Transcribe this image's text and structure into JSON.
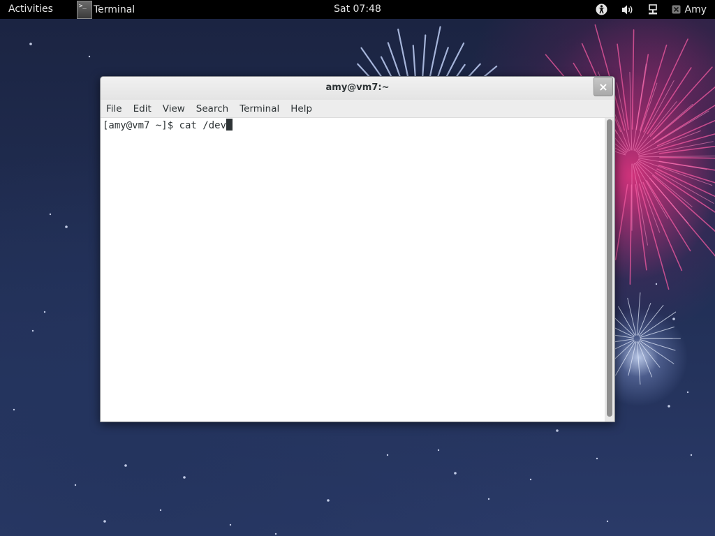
{
  "topbar": {
    "activities": "Activities",
    "app_name": "Terminal",
    "app_icon_glyph": ">_",
    "clock": "Sat 07:48",
    "user": "Amy",
    "icons": [
      "accessibility-icon",
      "volume-icon",
      "network-icon",
      "user-status-icon"
    ]
  },
  "window": {
    "title": "amy@vm7:~",
    "close_glyph": "×",
    "menu": [
      "File",
      "Edit",
      "View",
      "Search",
      "Terminal",
      "Help"
    ],
    "terminal": {
      "prompt": "[amy@vm7 ~]$ ",
      "command": "cat /dev"
    }
  },
  "colors": {
    "topbar_bg": "#000000",
    "wallpaper_base": "#1f2b4f",
    "firework_pink": "#e23a84",
    "terminal_text": "#2e3436"
  }
}
